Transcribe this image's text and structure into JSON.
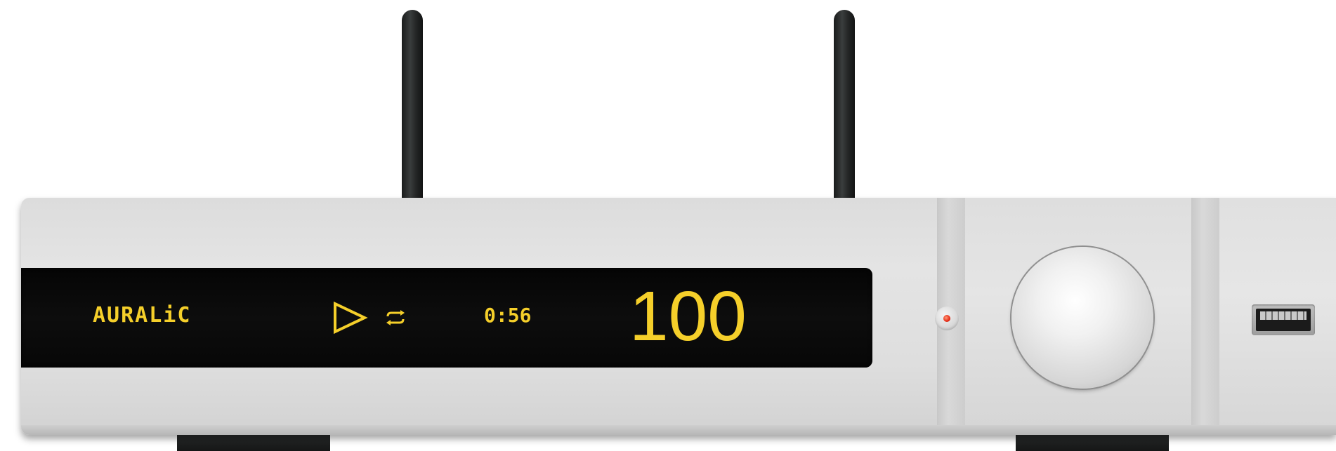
{
  "device": {
    "display": {
      "brand": "AURALiC",
      "play_icon": "play-icon",
      "repeat_icon": "repeat-icon",
      "time": "0:56",
      "volume": "100",
      "text_color": "#f5cf2a",
      "background_color": "#080808"
    },
    "chassis_color": "#e0e0e0",
    "antenna_color": "#222424",
    "status_led_color": "#e62a14",
    "knob": "volume-knob",
    "usb": "usb-port"
  }
}
